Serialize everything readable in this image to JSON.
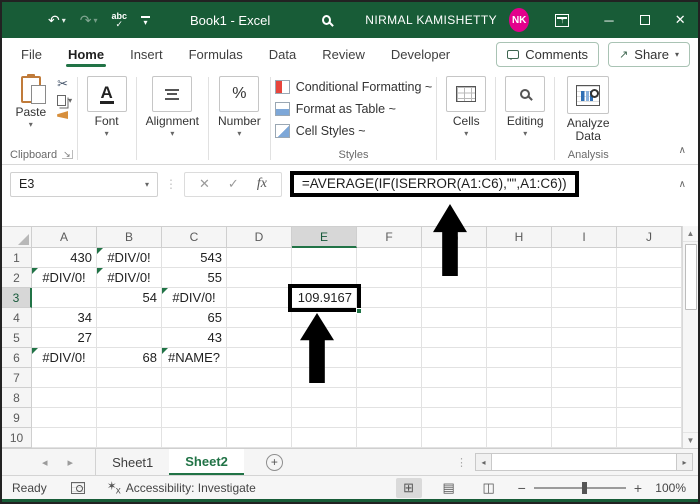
{
  "colors": {
    "accent": "#217346",
    "title_bar_bg": "#185c37",
    "avatar_bg": "#e3008c",
    "annotation_arrow": "#000000",
    "error_indicator": "#217346"
  },
  "title_bar": {
    "quick_access": {
      "undo_icon": "↶",
      "redo_icon": "↷",
      "spellcheck_label": "abc",
      "spellcheck_check": "✓"
    },
    "title": "Book1 - Excel",
    "user_name": "NIRMAL KAMISHETTY",
    "avatar_initials": "NK",
    "minimize_icon": "─",
    "close_icon": "✕"
  },
  "ribbon_tabs": {
    "items": [
      "File",
      "Home",
      "Insert",
      "Formulas",
      "Data",
      "Review",
      "Developer"
    ],
    "active_tab": "Home",
    "comments_label": "Comments",
    "share_label": "Share"
  },
  "ribbon": {
    "paste_label": "Paste",
    "clipboard_group_label": "Clipboard",
    "font_icon_letter": "A",
    "font_label": "Font",
    "alignment_label": "Alignment",
    "number_icon": "%",
    "number_label": "Number",
    "styles_items": [
      "Conditional Formatting ~",
      "Format as Table ~",
      "Cell Styles ~"
    ],
    "styles_group_label": "Styles",
    "cells_label": "Cells",
    "editing_label": "Editing",
    "analyze_label": "Analyze Data",
    "analysis_group_label": "Analysis"
  },
  "formula_bar": {
    "name_box": "E3",
    "cancel_icon": "✕",
    "enter_icon": "✓",
    "fx_label": "fx",
    "formula": "=AVERAGE(IF(ISERROR(A1:C6),\"\",A1:C6))"
  },
  "grid": {
    "columns": [
      "A",
      "B",
      "C",
      "D",
      "E",
      "F",
      "G",
      "H",
      "I",
      "J"
    ],
    "row_count": 10,
    "selected_column": "E",
    "selected_row": 3,
    "cells": [
      {
        "r": 1,
        "c": "A",
        "v": "430",
        "align": "right"
      },
      {
        "r": 1,
        "c": "B",
        "v": "#DIV/0!",
        "align": "center",
        "indicator": true
      },
      {
        "r": 1,
        "c": "C",
        "v": "543",
        "align": "right"
      },
      {
        "r": 2,
        "c": "A",
        "v": "#DIV/0!",
        "align": "center",
        "indicator": true
      },
      {
        "r": 2,
        "c": "B",
        "v": "#DIV/0!",
        "align": "center",
        "indicator": true
      },
      {
        "r": 2,
        "c": "C",
        "v": "55",
        "align": "right"
      },
      {
        "r": 3,
        "c": "B",
        "v": "54",
        "align": "right"
      },
      {
        "r": 3,
        "c": "C",
        "v": "#DIV/0!",
        "align": "center",
        "indicator": true
      },
      {
        "r": 3,
        "c": "E",
        "v": "109.9167",
        "align": "right",
        "boxed": true
      },
      {
        "r": 4,
        "c": "A",
        "v": "34",
        "align": "right"
      },
      {
        "r": 4,
        "c": "C",
        "v": "65",
        "align": "right"
      },
      {
        "r": 5,
        "c": "A",
        "v": "27",
        "align": "right"
      },
      {
        "r": 5,
        "c": "C",
        "v": "43",
        "align": "right"
      },
      {
        "r": 6,
        "c": "A",
        "v": "#DIV/0!",
        "align": "center",
        "indicator": true
      },
      {
        "r": 6,
        "c": "B",
        "v": "68",
        "align": "right"
      },
      {
        "r": 6,
        "c": "C",
        "v": "#NAME?",
        "align": "center",
        "indicator": true
      }
    ]
  },
  "sheet_tabs": {
    "tabs": [
      "Sheet1",
      "Sheet2"
    ],
    "active": "Sheet2",
    "add_label": "+"
  },
  "status_bar": {
    "mode": "Ready",
    "accessibility": "Accessibility: Investigate",
    "zoom_level": "100%"
  }
}
